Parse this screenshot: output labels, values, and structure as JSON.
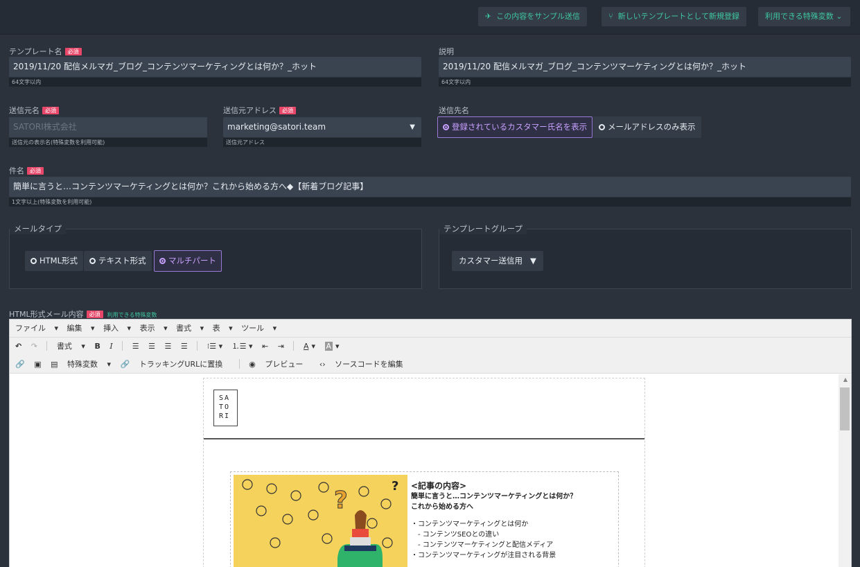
{
  "header": {
    "send_sample": "この内容をサンプル送信",
    "register_template": "新しいテンプレートとして新規登録",
    "special_vars": "利用できる特殊変数"
  },
  "required_badge": "必須",
  "template_name": {
    "label": "テンプレート名",
    "value": "2019/11/20 配信メルマガ_ブログ_コンテンツマーケティングとは何か？_ホット",
    "hint": "64文字以内"
  },
  "description": {
    "label": "説明",
    "value": "2019/11/20 配信メルマガ_ブログ_コンテンツマーケティングとは何か？_ホット",
    "hint": "64文字以内"
  },
  "sender_name": {
    "label": "送信元名",
    "placeholder": "SATORI株式会社",
    "hint": "送信元の表示名(特殊変数を利用可能)"
  },
  "sender_address": {
    "label": "送信元アドレス",
    "value": "marketing@satori.team",
    "hint": "送信元アドレス"
  },
  "recipient_name": {
    "label": "送信先名",
    "options": [
      "登録されているカスタマー氏名を表示",
      "メールアドレスのみ表示"
    ],
    "selected": 0
  },
  "subject": {
    "label": "件名",
    "value": "簡単に言うと…コンテンツマーケティングとは何か？これから始める方へ◆【新着ブログ記事】",
    "hint": "1文字以上(特殊変数を利用可能)"
  },
  "mail_type": {
    "legend": "メールタイプ",
    "options": [
      "HTML形式",
      "テキスト形式",
      "マルチパート"
    ],
    "selected": 2
  },
  "template_group": {
    "legend": "テンプレートグループ",
    "value": "カスタマー送信用"
  },
  "html_content": {
    "label": "HTML形式メール内容",
    "special_vars_link": "利用できる特殊変数"
  },
  "editor": {
    "menu": [
      "ファイル",
      "編集",
      "挿入",
      "表示",
      "書式",
      "表",
      "ツール"
    ],
    "format_label": "書式",
    "special_vars": "特殊変数",
    "tracking": "トラッキングURLに置換",
    "preview": "プレビュー",
    "source": "ソースコードを編集"
  },
  "mail_preview": {
    "logo_lines": [
      "SA",
      "TO",
      "RI"
    ],
    "heading": "<記事の内容>",
    "title_lines": [
      "簡単に言うと…コンテンツマーケティングとは何か？",
      "これから始める方へ"
    ],
    "bullets": [
      "・コンテンツマーケティングとは何か",
      "　- コンテンツSEOとの違い",
      "　- コンテンツマーケティングと配信メディア",
      "・コンテンツマーケティングが注目される背景"
    ]
  },
  "colors": {
    "accent": "#3fc7a0",
    "required": "#e8476a",
    "selected": "#c8a0ff"
  }
}
